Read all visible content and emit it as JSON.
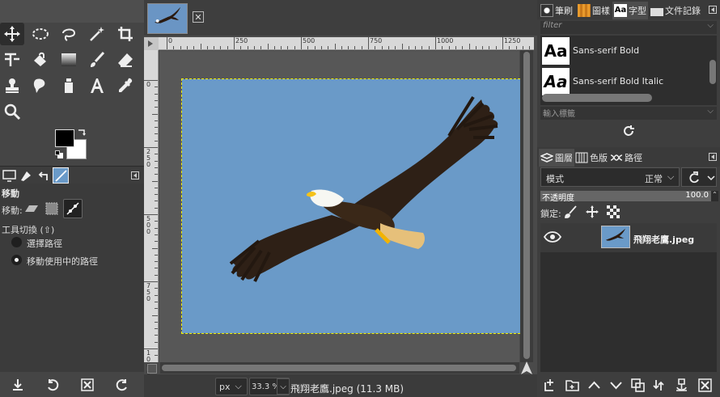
{
  "toolbox": {
    "tools": [
      {
        "id": "move-tool",
        "icon": "move-icon"
      },
      {
        "id": "ellipse-select-tool",
        "icon": "ellipse-select-icon"
      },
      {
        "id": "free-select-tool",
        "icon": "lasso-icon"
      },
      {
        "id": "fuzzy-select-tool",
        "icon": "magic-wand-icon"
      },
      {
        "id": "crop-tool",
        "icon": "crop-icon"
      },
      {
        "id": "warp-tool",
        "icon": "warp-icon"
      },
      {
        "id": "bucket-fill-tool",
        "icon": "bucket-icon"
      },
      {
        "id": "gradient-tool",
        "icon": "gradient-icon"
      },
      {
        "id": "paintbrush-tool",
        "icon": "brush-icon"
      },
      {
        "id": "eraser-tool",
        "icon": "eraser-icon"
      },
      {
        "id": "clone-tool",
        "icon": "stamp-icon"
      },
      {
        "id": "smudge-tool",
        "icon": "smudge-icon"
      },
      {
        "id": "dodge-tool",
        "icon": "dodge-icon"
      },
      {
        "id": "text-tool",
        "icon": "text-icon"
      },
      {
        "id": "color-picker-tool",
        "icon": "eyedropper-icon"
      },
      {
        "id": "zoom-tool",
        "icon": "magnifier-icon"
      }
    ],
    "fg_color": "#000000",
    "bg_color": "#ffffff"
  },
  "tool_options": {
    "title": "移動",
    "move_label": "移動:",
    "toggle_label": "工具切換 (⇧)",
    "radio_1": "選擇路徑",
    "radio_2": "移動使用中的路徑",
    "selected_radio": 2
  },
  "canvas": {
    "ruler_labels": [
      "0",
      "250",
      "500",
      "750",
      "1000",
      "1250"
    ],
    "ruler_left_labels": [
      "0",
      "250",
      "500",
      "750",
      "1000"
    ],
    "photo_bg": "#6a9ac8"
  },
  "status": {
    "unit": "px",
    "zoom": "33.3 %",
    "file_info": "飛翔老鷹.jpeg (11.3 MB)"
  },
  "right_top": {
    "tabs": [
      "筆刷",
      "圖樣",
      "字型",
      "文件記錄"
    ],
    "filter_placeholder": "filter",
    "fonts": [
      {
        "preview": "Aa",
        "name": "Sans-serif Bold"
      },
      {
        "preview": "Aa",
        "name": "Sans-serif Bold Italic"
      }
    ],
    "tag_placeholder": "輸入標籤"
  },
  "right_bottom": {
    "tabs": [
      "圖層",
      "色版",
      "路徑"
    ],
    "mode_label": "模式",
    "mode_value": "正常",
    "opacity_label": "不透明度",
    "opacity_value": "100.0",
    "lock_label": "鎖定:",
    "layer_name": "飛翔老鷹.jpeg"
  }
}
